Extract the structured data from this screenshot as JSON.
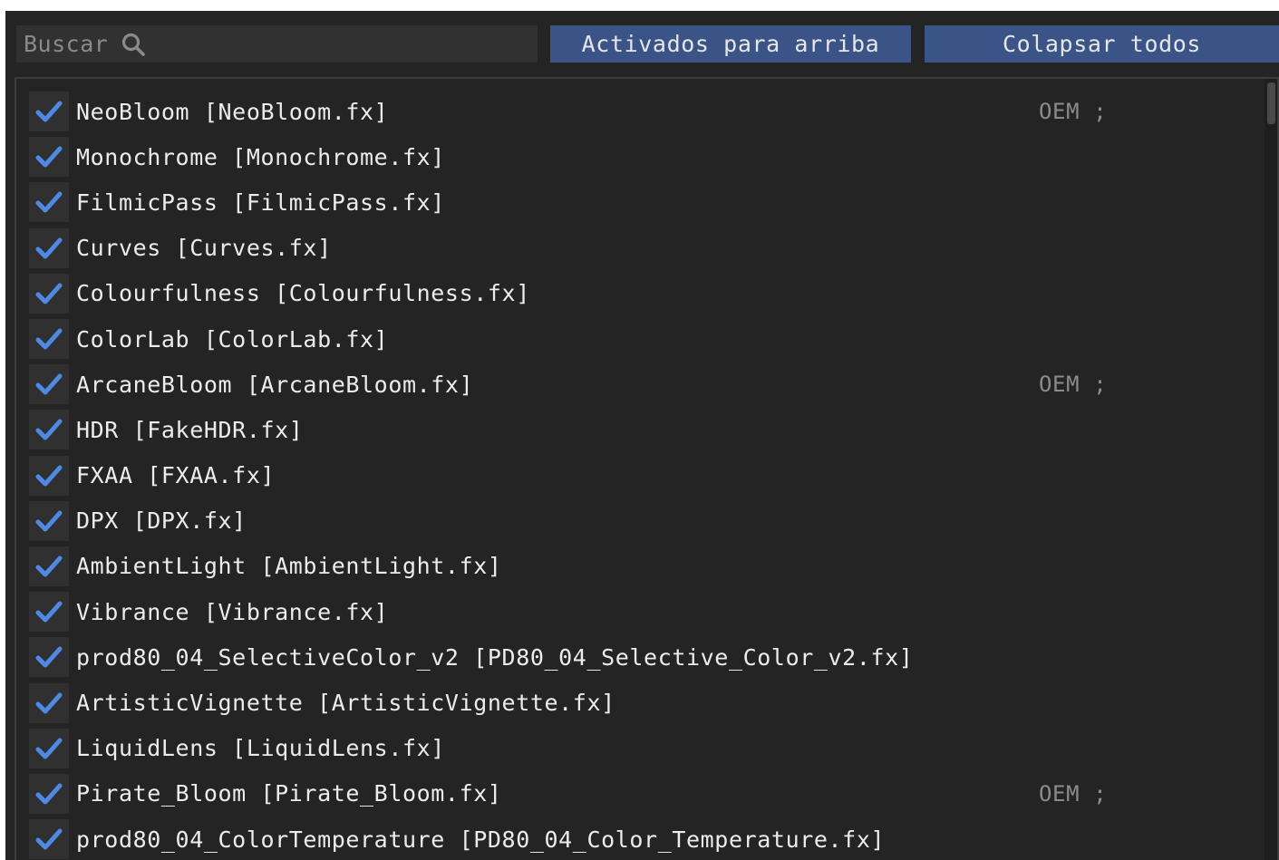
{
  "colors": {
    "accent_button": "#3a5488",
    "checkmark": "#4d8ae6",
    "background": "#242424"
  },
  "toolbar": {
    "search_placeholder": "Buscar",
    "search_icon": "search-icon",
    "activated_up_label": "Activados para arriba",
    "collapse_all_label": "Colapsar todos"
  },
  "effects": [
    {
      "label": "NeoBloom [NeoBloom.fx]",
      "tag": "OEM ;",
      "checked": true
    },
    {
      "label": "Monochrome [Monochrome.fx]",
      "tag": "",
      "checked": true
    },
    {
      "label": "FilmicPass [FilmicPass.fx]",
      "tag": "",
      "checked": true
    },
    {
      "label": "Curves [Curves.fx]",
      "tag": "",
      "checked": true
    },
    {
      "label": "Colourfulness [Colourfulness.fx]",
      "tag": "",
      "checked": true
    },
    {
      "label": "ColorLab [ColorLab.fx]",
      "tag": "",
      "checked": true
    },
    {
      "label": "ArcaneBloom [ArcaneBloom.fx]",
      "tag": "OEM ;",
      "checked": true
    },
    {
      "label": "HDR [FakeHDR.fx]",
      "tag": "",
      "checked": true
    },
    {
      "label": "FXAA [FXAA.fx]",
      "tag": "",
      "checked": true
    },
    {
      "label": "DPX [DPX.fx]",
      "tag": "",
      "checked": true
    },
    {
      "label": "AmbientLight [AmbientLight.fx]",
      "tag": "",
      "checked": true
    },
    {
      "label": "Vibrance [Vibrance.fx]",
      "tag": "",
      "checked": true
    },
    {
      "label": "prod80_04_SelectiveColor_v2 [PD80_04_Selective_Color_v2.fx]",
      "tag": "",
      "checked": true
    },
    {
      "label": "ArtisticVignette [ArtisticVignette.fx]",
      "tag": "",
      "checked": true
    },
    {
      "label": "LiquidLens [LiquidLens.fx]",
      "tag": "",
      "checked": true
    },
    {
      "label": "Pirate_Bloom [Pirate_Bloom.fx]",
      "tag": "OEM ;",
      "checked": true
    },
    {
      "label": "prod80_04_ColorTemperature [PD80_04_Color_Temperature.fx]",
      "tag": "",
      "checked": true
    }
  ]
}
